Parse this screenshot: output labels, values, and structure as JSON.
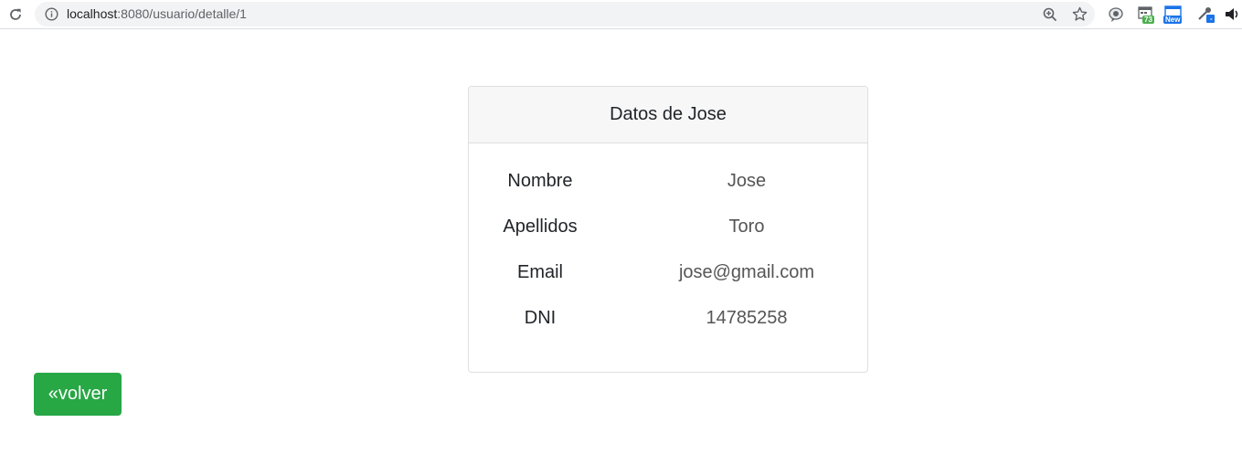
{
  "browser": {
    "url_host": "localhost",
    "url_path": ":8080/usuario/detalle/1",
    "extensions": [
      {
        "icon": "gear-badge-icon",
        "badge": ""
      },
      {
        "icon": "calendar-ext-icon",
        "badge": "73"
      },
      {
        "icon": "window-ext-icon",
        "badge": "New"
      },
      {
        "icon": "eyedropper-ext-icon",
        "badge": "-"
      },
      {
        "icon": "speaker-icon",
        "badge": ""
      }
    ],
    "colors": {
      "badge_green": "#4caf50",
      "badge_blue": "#1a73e8"
    }
  },
  "card": {
    "title": "Datos de Jose",
    "fields": [
      {
        "label": "Nombre",
        "value": "Jose"
      },
      {
        "label": "Apellidos",
        "value": "Toro"
      },
      {
        "label": "Email",
        "value": "jose@gmail.com"
      },
      {
        "label": "DNI",
        "value": "14785258"
      }
    ]
  },
  "actions": {
    "back_label": "«volver",
    "back_color": "#28a745"
  }
}
